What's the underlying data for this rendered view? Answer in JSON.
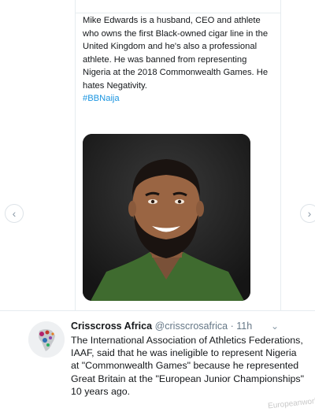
{
  "tweet1": {
    "text": "Mike Edwards is a husband, CEO and athlete who owns the first Black-owned cigar line in the United Kingdom and he's also a professional athlete. He was banned from representing Nigeria at the 2018 Commonwealth Games. He hates Negativity.",
    "hashtag": "#BBNaija",
    "photo_icon": "person-portrait-photo"
  },
  "carousel": {
    "prev_icon": "chevron-left-icon",
    "next_icon": "chevron-right-icon"
  },
  "tweet2": {
    "name": "Crisscross Africa",
    "handle": "@crisscrosafrica",
    "separator": " · ",
    "time": "11h",
    "menu_icon": "chevron-down-icon",
    "avatar_icon": "africa-map-avatar",
    "body": "The International Association of Athletics Federations, IAAF, said that he was ineligible to represent Nigeria at \"Commonwealth Games\" because he represented Great Britain at the \"European Junior Championships\" 10 years ago."
  },
  "watermark": "Europeanworld"
}
